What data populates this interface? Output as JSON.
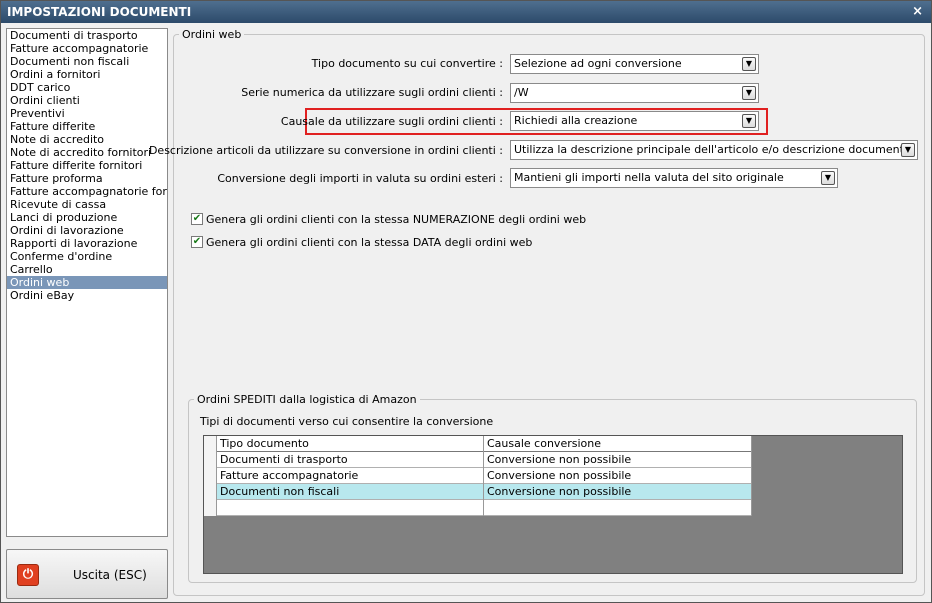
{
  "window": {
    "title": "IMPOSTAZIONI DOCUMENTI",
    "close_symbol": "×"
  },
  "sidebar": {
    "items": [
      "Documenti di trasporto",
      "Fatture accompagnatorie",
      "Documenti non fiscali",
      "Ordini a fornitori",
      "DDT carico",
      "Ordini clienti",
      "Preventivi",
      "Fatture differite",
      "Note di accredito",
      "Note di accredito fornitori",
      "Fatture differite fornitori",
      "Fatture proforma",
      "Fatture accompagnatorie fornito",
      "Ricevute di cassa",
      "Lanci di produzione",
      "Ordini di lavorazione",
      "Rapporti di lavorazione",
      "Conferme d'ordine",
      "Carrello",
      "Ordini web",
      "Ordini eBay"
    ],
    "selected": "Ordini web"
  },
  "exit_button": {
    "icon": "power-icon",
    "icon_symbol": "⏻",
    "label": "Uscita (ESC)"
  },
  "main": {
    "group_title": "Ordini web",
    "rows": [
      {
        "label": "Tipo documento su cui convertire :",
        "value": "Selezione ad ogni conversione"
      },
      {
        "label": "Serie numerica da utilizzare sugli ordini clienti :",
        "value": "/W"
      },
      {
        "label": "Causale da utilizzare sugli ordini clienti :",
        "value": "Richiedi alla creazione"
      },
      {
        "label": "Descrizione articoli da utilizzare su conversione in ordini clienti :",
        "value": "Utilizza la descrizione principale dell'articolo e/o descrizione documenti"
      },
      {
        "label": "Conversione degli importi in valuta su ordini esteri :",
        "value": "Mantieni gli importi nella valuta del sito originale"
      }
    ],
    "checkboxes": [
      {
        "label": "Genera gli ordini clienti con la stessa NUMERAZIONE degli ordini web",
        "checked": true
      },
      {
        "label": "Genera gli ordini clienti con la stessa DATA degli ordini web",
        "checked": true
      }
    ],
    "amazon": {
      "group_title": "Ordini SPEDITI dalla logistica di Amazon",
      "subtitle": "Tipi di documenti verso cui consentire la conversione",
      "columns": [
        "Tipo documento",
        "Causale conversione"
      ],
      "rows": [
        [
          "Documenti di trasporto",
          "Conversione non possibile"
        ],
        [
          "Fatture accompagnatorie",
          "Conversione non possibile"
        ],
        [
          "Documenti non fiscali",
          "Conversione non possibile"
        ],
        [
          "",
          ""
        ]
      ],
      "selected_row": 2
    }
  },
  "colors": {
    "titlebar": "#2c4a6a",
    "selected_item": "#7a96b8",
    "highlight_border": "#e02020",
    "selected_row": "#b8e8ee",
    "grid_background": "#808080"
  }
}
